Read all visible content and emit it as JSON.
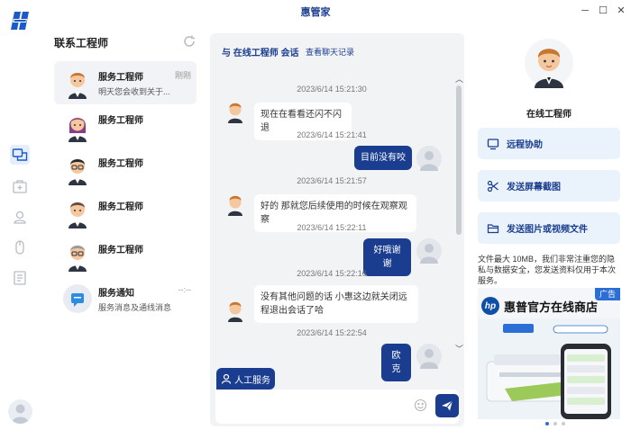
{
  "window": {
    "title": "惠管家",
    "min_icon": "minimize-icon",
    "max_icon": "maximize-icon",
    "close_icon": "close-icon"
  },
  "rail": {
    "items": [
      "chat-icon",
      "toolbox-icon",
      "user-icon",
      "mouse-icon",
      "document-icon"
    ],
    "active": 0
  },
  "contacts": {
    "title": "联系工程师",
    "items": [
      {
        "name": "服务工程师",
        "time": "刚刚",
        "preview": "明天您会收到关于..."
      },
      {
        "name": "服务工程师",
        "time": "",
        "preview": ""
      },
      {
        "name": "服务工程师",
        "time": "",
        "preview": ""
      },
      {
        "name": "服务工程师",
        "time": "",
        "preview": ""
      },
      {
        "name": "服务工程师",
        "time": "",
        "preview": ""
      },
      {
        "name": "服务通知",
        "time": "--:--",
        "preview": "服务消息及通线消息"
      }
    ]
  },
  "chat": {
    "title": "与 在线工程师 会话",
    "history_link": "查看聊天记录",
    "messages": [
      {
        "time": "2023/6/14 15:21:30",
        "side": "in",
        "text": "现在在看看还闪不闪退"
      },
      {
        "time": "2023/6/14 15:21:41",
        "side": "out",
        "text": "目前没有咬"
      },
      {
        "time": "2023/6/14 15:21:57",
        "side": "in",
        "text": "好的 那就您后续使用的时候在观察观察"
      },
      {
        "time": "2023/6/14 15:22:11",
        "side": "out",
        "text": "好哦谢谢"
      },
      {
        "time": "2023/6/14 15:22:16",
        "side": "in",
        "text": "没有其他问题的话 小惠这边就关闭远程退出会话了哈"
      },
      {
        "time": "2023/6/14 15:22:54",
        "side": "out",
        "text": "欧克"
      }
    ],
    "human_button": "人工服务",
    "input_value": ""
  },
  "panel": {
    "engineer_label": "在线工程师",
    "actions": [
      {
        "label": "远程协助",
        "icon": "monitor-icon"
      },
      {
        "label": "发送屏幕截图",
        "icon": "scissors-icon"
      },
      {
        "label": "发送图片或视频文件",
        "icon": "folder-icon"
      }
    ],
    "note": "文件最大 10MB，我们非常注重您的隐私与数据安全，您发送资料仅用于本次服务。",
    "ad": {
      "badge": "广告",
      "logo": "hp",
      "title": "惠普官方在线商店"
    },
    "carousel": {
      "count": 3,
      "active": 0
    }
  }
}
